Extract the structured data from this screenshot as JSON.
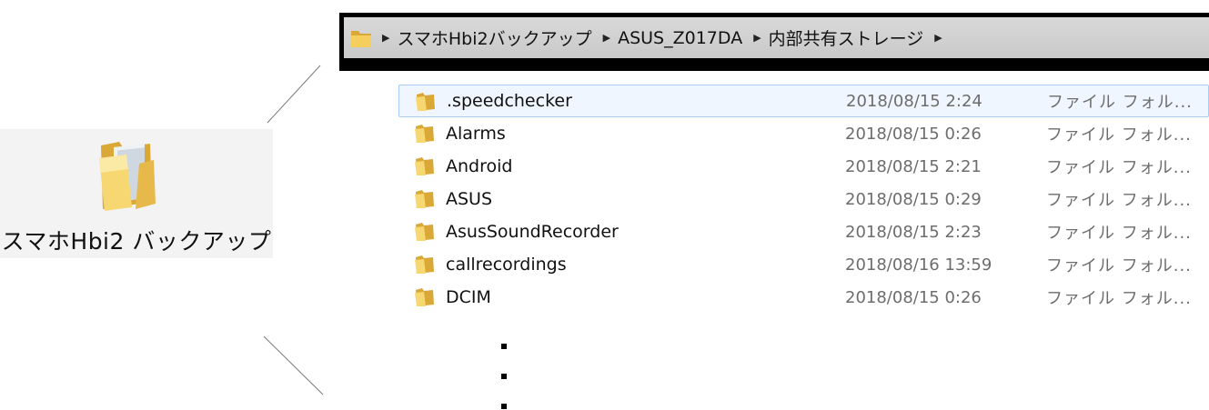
{
  "desktop_icon": {
    "label": "スマホHbi2 バックアップ",
    "icon": "folder-icon"
  },
  "address_bar": {
    "icon": "folder-icon",
    "breadcrumbs": [
      "スマホHbi2バックアップ",
      "ASUS_Z017DA",
      "内部共有ストレージ"
    ]
  },
  "files": [
    {
      "name": ".speedchecker",
      "date": "2018/08/15 2:24",
      "type": "ファイル フォル...",
      "selected": true
    },
    {
      "name": "Alarms",
      "date": "2018/08/15 0:26",
      "type": "ファイル フォル..."
    },
    {
      "name": "Android",
      "date": "2018/08/15 2:21",
      "type": "ファイル フォル..."
    },
    {
      "name": "ASUS",
      "date": "2018/08/15 0:29",
      "type": "ファイル フォル..."
    },
    {
      "name": "AsusSoundRecorder",
      "date": "2018/08/15 2:23",
      "type": "ファイル フォル..."
    },
    {
      "name": "callrecordings",
      "date": "2018/08/16 13:59",
      "type": "ファイル フォル..."
    },
    {
      "name": "DCIM",
      "date": "2018/08/15 0:26",
      "type": "ファイル フォル..."
    }
  ],
  "colors": {
    "folder": "#f2c94c",
    "selection_bg": "#f0f6ff",
    "selection_border": "#a9ccf0"
  }
}
